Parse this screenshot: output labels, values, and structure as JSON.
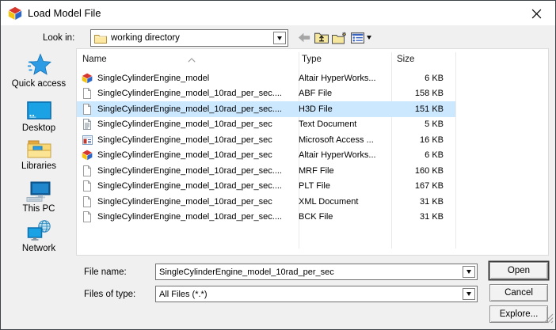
{
  "window": {
    "title": "Load Model File"
  },
  "look_in": {
    "label": "Look in:",
    "value": "working directory",
    "folder_icon": "folder"
  },
  "toolbar": {
    "icons": [
      "back",
      "up-one-level",
      "create-new-folder",
      "view-menu"
    ]
  },
  "sidebar": {
    "items": [
      {
        "label": "Quick access",
        "icon": "quick-access"
      },
      {
        "label": "Desktop",
        "icon": "desktop"
      },
      {
        "label": "Libraries",
        "icon": "libraries"
      },
      {
        "label": "This PC",
        "icon": "this-pc"
      },
      {
        "label": "Network",
        "icon": "network"
      }
    ]
  },
  "file_list": {
    "columns": [
      {
        "label": "Name"
      },
      {
        "label": "Type"
      },
      {
        "label": "Size"
      }
    ],
    "sort": {
      "column": "Name",
      "direction": "ascending"
    },
    "rows": [
      {
        "name": "SingleCylinderEngine_model",
        "type": "Altair HyperWorks...",
        "size": "6 KB",
        "icon": "hyperworks",
        "selected": false
      },
      {
        "name": "SingleCylinderEngine_model_10rad_per_sec....",
        "type": "ABF File",
        "size": "158 KB",
        "icon": "file",
        "selected": false
      },
      {
        "name": "SingleCylinderEngine_model_10rad_per_sec....",
        "type": "H3D File",
        "size": "151 KB",
        "icon": "file",
        "selected": true
      },
      {
        "name": "SingleCylinderEngine_model_10rad_per_sec",
        "type": "Text Document",
        "size": "5 KB",
        "icon": "text",
        "selected": false
      },
      {
        "name": "SingleCylinderEngine_model_10rad_per_sec",
        "type": "Microsoft Access ...",
        "size": "16 KB",
        "icon": "access",
        "selected": false
      },
      {
        "name": "SingleCylinderEngine_model_10rad_per_sec",
        "type": "Altair HyperWorks...",
        "size": "6 KB",
        "icon": "hyperworks",
        "selected": false
      },
      {
        "name": "SingleCylinderEngine_model_10rad_per_sec....",
        "type": "MRF File",
        "size": "160 KB",
        "icon": "file",
        "selected": false
      },
      {
        "name": "SingleCylinderEngine_model_10rad_per_sec....",
        "type": "PLT File",
        "size": "167 KB",
        "icon": "file",
        "selected": false
      },
      {
        "name": "SingleCylinderEngine_model_10rad_per_sec",
        "type": "XML Document",
        "size": "31 KB",
        "icon": "file",
        "selected": false
      },
      {
        "name": "SingleCylinderEngine_model_10rad_per_sec....",
        "type": "BCK File",
        "size": "31 KB",
        "icon": "file",
        "selected": false
      }
    ]
  },
  "file_name": {
    "label": "File name:",
    "value": "SingleCylinderEngine_model_10rad_per_sec"
  },
  "files_of_type": {
    "label": "Files of type:",
    "value": "All Files (*.*)"
  },
  "buttons": {
    "open": "Open",
    "cancel": "Cancel",
    "explore": "Explore..."
  },
  "colors": {
    "dialog_bg": "#f0f0f0",
    "titlebar_bg": "#ffffff",
    "selection_bg": "#cce8ff",
    "folder_yellow": "#ffe9a2",
    "accent_blue": "#2d9ce4"
  }
}
